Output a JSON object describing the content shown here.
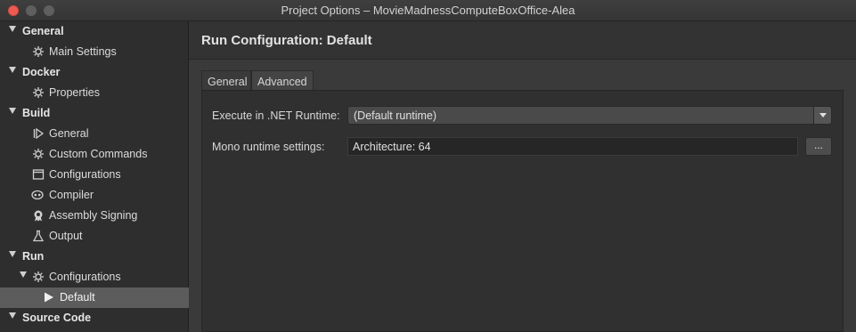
{
  "window": {
    "title": "Project Options – MovieMadnessComputeBoxOffice-Alea"
  },
  "sidebar": {
    "sections": [
      {
        "label": "General",
        "items": [
          {
            "label": "Main Settings",
            "icon": "gear-icon"
          }
        ]
      },
      {
        "label": "Docker",
        "items": [
          {
            "label": "Properties",
            "icon": "gear-icon"
          }
        ]
      },
      {
        "label": "Build",
        "items": [
          {
            "label": "General",
            "icon": "play-bar-icon"
          },
          {
            "label": "Custom Commands",
            "icon": "gear-icon"
          },
          {
            "label": "Configurations",
            "icon": "window-icon"
          },
          {
            "label": "Compiler",
            "icon": "compiler-icon"
          },
          {
            "label": "Assembly Signing",
            "icon": "seal-icon"
          },
          {
            "label": "Output",
            "icon": "flask-icon"
          }
        ]
      },
      {
        "label": "Run",
        "items": [
          {
            "label": "Configurations",
            "icon": "gear-icon"
          },
          {
            "label": "Default",
            "icon": "play-icon"
          }
        ]
      },
      {
        "label": "Source Code",
        "items": []
      }
    ]
  },
  "main": {
    "title": "Run Configuration: Default",
    "tabs": [
      {
        "label": "General"
      },
      {
        "label": "Advanced"
      }
    ],
    "runtime_label": "Execute in .NET Runtime:",
    "runtime_value": "(Default runtime)",
    "mono_label": "Mono runtime settings:",
    "mono_value": "Architecture: 64",
    "mono_button": "..."
  },
  "colors": {
    "close": "#ee5b50",
    "selected_row": "#5c5c5c"
  }
}
